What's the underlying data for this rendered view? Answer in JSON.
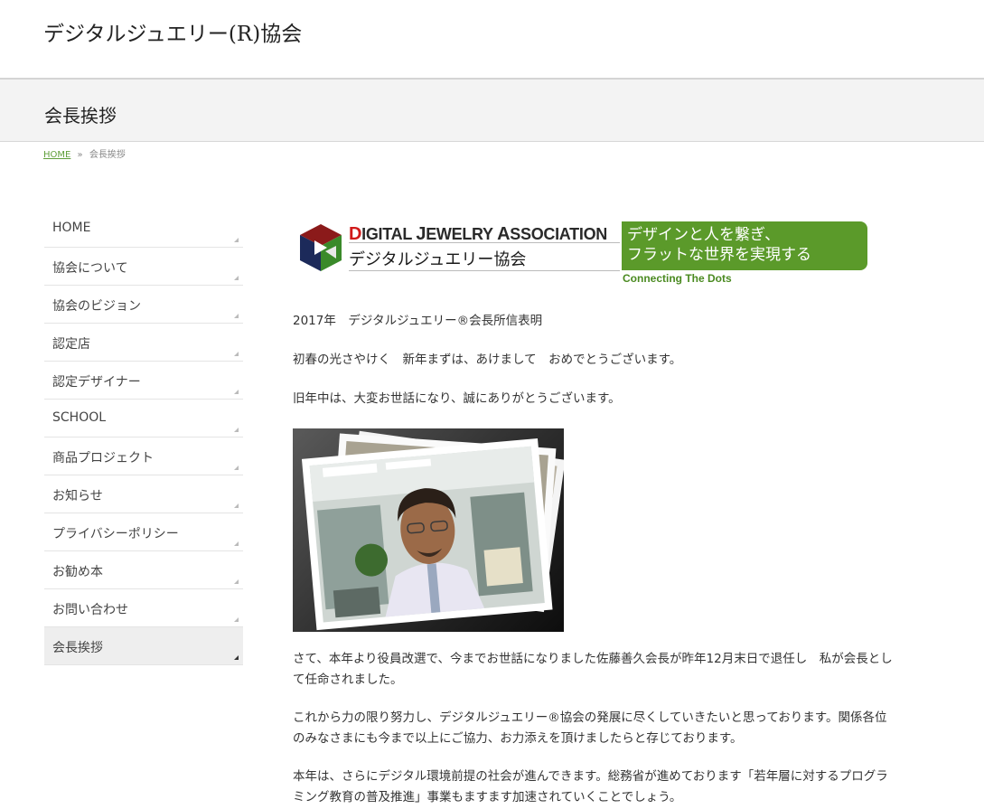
{
  "site": {
    "title": "デジタルジュエリー(R)協会"
  },
  "page": {
    "title": "会長挨拶"
  },
  "breadcrumb": {
    "home": "HOME",
    "separator": "»",
    "current": "会長挨拶"
  },
  "sidebar": {
    "items": [
      {
        "label": "HOME"
      },
      {
        "label": "協会について"
      },
      {
        "label": "協会のビジョン"
      },
      {
        "label": "認定店"
      },
      {
        "label": "認定デザイナー"
      },
      {
        "label": "SCHOOL"
      },
      {
        "label": "商品プロジェクト"
      },
      {
        "label": "お知らせ"
      },
      {
        "label": "プライバシーポリシー"
      },
      {
        "label": "お勧め本"
      },
      {
        "label": "お問い合わせ"
      },
      {
        "label": "会長挨拶",
        "active": true
      }
    ]
  },
  "banner": {
    "name_d": "D",
    "name_part1": "IGITAL ",
    "name_j": "J",
    "name_part2": "EWELRY ",
    "name_a": "A",
    "name_part3": "SSOCIATION",
    "japanese": "デジタルジュエリー協会",
    "slogan_line1": "デザインと人を繋ぎ、",
    "slogan_line2": "フラットな世界を実現する",
    "tagline": "Connecting The Dots"
  },
  "content": {
    "year_statement": "2017年　デジタルジュエリー®会長所信表明",
    "greeting": "初春の光さやけく　新年まずは、あけまして　おめでとうございます。",
    "thanks": "旧年中は、大変お世話になり、誠にありがとうございます。",
    "leadership_change": "さて、本年より役員改選で、今までお世話になりました佐藤善久会長が昨年12月末日で退任し　私が会長として任命されました。",
    "effort": "これから力の限り努力し、デジタルジュエリー®協会の発展に尽くしていきたいと思っております。関係各位のみなさまにも今まで以上にご協力、お力添えを頂けましたらと存じております。",
    "digital_society": "本年は、さらにデジタル環境前提の社会が進んできます。総務省が進めております「若年層に対するプログラミング教育の普及推進」事業もますます加速されていくことでしょう。"
  },
  "colors": {
    "accent_green": "#5b9a2a",
    "link_green": "#5f9e3a",
    "logo_red": "#d11a1a",
    "band_bg": "#f3f3f3"
  }
}
